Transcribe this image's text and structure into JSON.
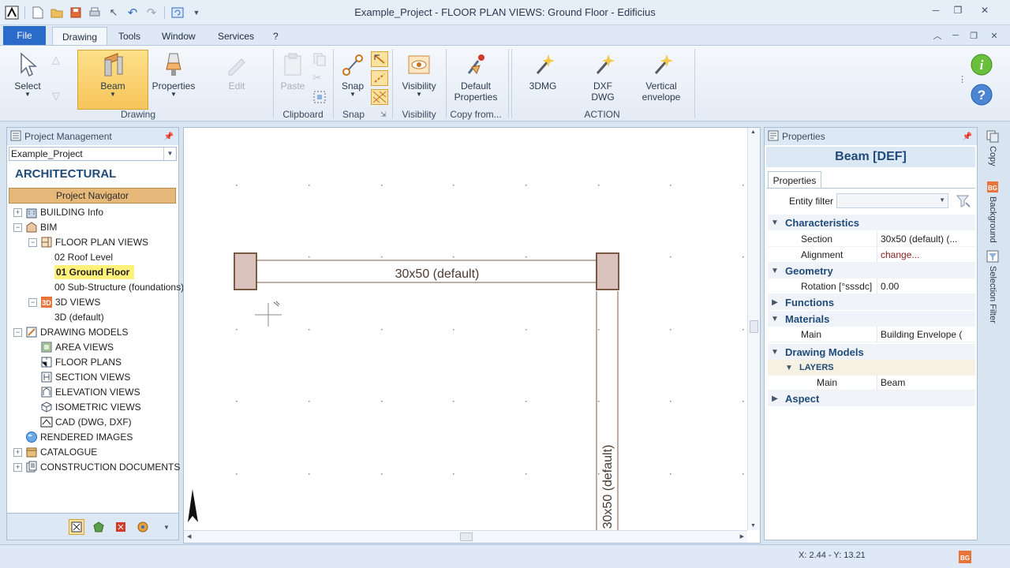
{
  "window": {
    "title": "Example_Project -  FLOOR PLAN VIEWS: Ground Floor - Edificius",
    "controls": [
      "minimize",
      "maximize",
      "close"
    ]
  },
  "menu": {
    "file": "File",
    "tabs": [
      "Drawing",
      "Tools",
      "Window",
      "Services",
      "?"
    ],
    "active_tab": "Drawing"
  },
  "ribbon": {
    "buttons": {
      "select": "Select",
      "beam": "Beam",
      "properties": "Properties",
      "edit": "Edit",
      "paste": "Paste",
      "snap": "Snap",
      "visibility": "Visibility",
      "default_properties": "Default Properties",
      "dmg3": "3DMG",
      "dxf_dwg": "DXF DWG",
      "vertical_envelope": "Vertical envelope"
    },
    "groups": {
      "drawing": "Drawing",
      "clipboard": "Clipboard",
      "snap": "Snap",
      "visibility": "Visibility",
      "copy_from": "Copy from...",
      "action": "ACTION"
    }
  },
  "left_panel": {
    "title": "Project Management",
    "project": "Example_Project",
    "section_title": "ARCHITECTURAL",
    "navigator": "Project Navigator",
    "tree": [
      {
        "label": "BUILDING Info",
        "level": 0,
        "expander": "+",
        "icon": "building-icon"
      },
      {
        "label": "BIM",
        "level": 0,
        "expander": "-",
        "icon": "bim-icon"
      },
      {
        "label": "FLOOR PLAN VIEWS",
        "level": 1,
        "expander": "-",
        "icon": "floor-plan-icon"
      },
      {
        "label": "02 Roof Level",
        "level": 2
      },
      {
        "label": "01 Ground Floor",
        "level": 2,
        "selected": true
      },
      {
        "label": "00 Sub-Structure (foundations)",
        "level": 2
      },
      {
        "label": "3D VIEWS",
        "level": 1,
        "expander": "-",
        "icon": "3d-icon"
      },
      {
        "label": "3D (default)",
        "level": 2
      },
      {
        "label": "DRAWING MODELS",
        "level": 0,
        "expander": "-",
        "icon": "drawing-models-icon"
      },
      {
        "label": "AREA VIEWS",
        "level": 1,
        "icon": "area-views-icon"
      },
      {
        "label": "FLOOR PLANS",
        "level": 1,
        "icon": "floor-plans-icon"
      },
      {
        "label": "SECTION VIEWS",
        "level": 1,
        "icon": "section-views-icon"
      },
      {
        "label": "ELEVATION VIEWS",
        "level": 1,
        "icon": "elevation-views-icon"
      },
      {
        "label": "ISOMETRIC VIEWS",
        "level": 1,
        "icon": "isometric-views-icon"
      },
      {
        "label": "CAD (DWG, DXF)",
        "level": 1,
        "icon": "cad-icon"
      },
      {
        "label": "RENDERED IMAGES",
        "level": 0,
        "icon": "rendered-images-icon"
      },
      {
        "label": "CATALOGUE",
        "level": 0,
        "expander": "+",
        "icon": "catalogue-icon"
      },
      {
        "label": "CONSTRUCTION DOCUMENTS SET",
        "level": 0,
        "expander": "+",
        "icon": "documents-icon"
      }
    ]
  },
  "canvas": {
    "beam_label_h": "30x50 (default)",
    "beam_label_v": "30x50 (default)"
  },
  "properties_panel": {
    "title": "Properties",
    "object_title": "Beam [DEF]",
    "tab": "Properties",
    "entity_filter_label": "Entity filter",
    "rows": [
      {
        "type": "cat",
        "label": "Characteristics",
        "expanded": true
      },
      {
        "type": "prop",
        "key": "Section",
        "value": "30x50 (default)  (..."
      },
      {
        "type": "prop",
        "key": "Alignment",
        "value": "change...",
        "value_color": "#8a1a1a"
      },
      {
        "type": "cat",
        "label": "Geometry",
        "expanded": true
      },
      {
        "type": "prop",
        "key": "Rotation  [°sssdc]",
        "value": "0.00"
      },
      {
        "type": "cat",
        "label": "Functions",
        "expanded": false
      },
      {
        "type": "cat",
        "label": "Materials",
        "expanded": true
      },
      {
        "type": "prop",
        "key": "Main",
        "value": "Building Envelope ("
      },
      {
        "type": "cat",
        "label": "Drawing Models",
        "expanded": true
      },
      {
        "type": "subcat",
        "label": "LAYERS"
      },
      {
        "type": "prop",
        "key": "Main",
        "value": "Beam",
        "indent": 2
      },
      {
        "type": "cat",
        "label": "Aspect",
        "expanded": false
      }
    ]
  },
  "side_tabs": [
    "Copy",
    "Background",
    "Selection Filter"
  ],
  "status": {
    "coordinates": "X: 2.44 - Y: 13.21"
  },
  "colors": {
    "accent": "#2a6ac8",
    "selected_ribbon": "#f7c55a",
    "selected_tree": "#fff17a",
    "beam_stroke": "#7a5a45",
    "column_fill": "#d9c3bc"
  }
}
